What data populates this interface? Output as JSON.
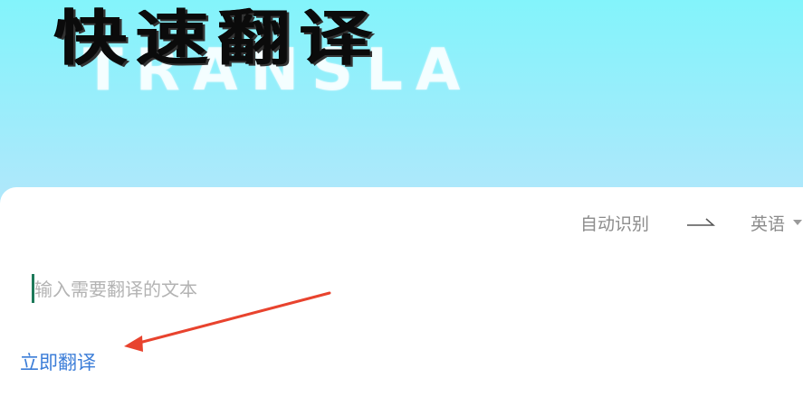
{
  "banner": {
    "title": "快速翻译",
    "bg_text": "TRANSLA"
  },
  "language_bar": {
    "source_language": "自动识别",
    "target_language": "英语"
  },
  "input": {
    "placeholder": "输入需要翻译的文本",
    "value": ""
  },
  "actions": {
    "translate_label": "立即翻译"
  },
  "colors": {
    "accent": "#3b7dd8",
    "annotation_arrow": "#e8432e",
    "banner_top": "#83f4fb",
    "banner_bottom": "#b2e7fb",
    "caret": "#1d7a5a"
  },
  "icons": {
    "swap": "swap-arrow-icon",
    "dropdown": "caret-down-icon"
  }
}
